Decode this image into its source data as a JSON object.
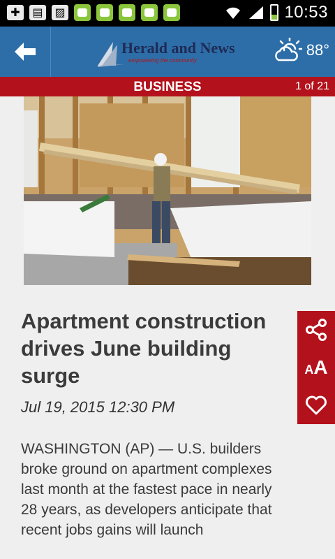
{
  "status_bar": {
    "time": "10:53",
    "battery_level": 0.35,
    "icons": [
      "add-icon",
      "sim-icon",
      "image-icon",
      "android-icon",
      "android-icon",
      "android-icon",
      "android-icon",
      "android-icon",
      "wifi-icon",
      "signal-icon",
      "battery-icon"
    ]
  },
  "header": {
    "logo_title": "Herald and News",
    "logo_tagline": "empowering the community",
    "weather": {
      "icon": "partly-sunny-icon",
      "temperature": "88°"
    }
  },
  "section": {
    "title": "BUSINESS",
    "page_count": "1 of 21"
  },
  "article": {
    "headline": "Apartment construction drives June building surge",
    "date": "Jul 19, 2015 12:30 PM",
    "body": "WASHINGTON (AP) — U.S. builders broke ground on apartment complexes last month at the fastest pace in nearly 28 years, as developers anticipate that recent jobs gains will launch"
  },
  "actions": {
    "font_small": "A",
    "font_big": "A"
  },
  "colors": {
    "header_blue": "#2d6ea8",
    "accent_red": "#b3121c",
    "background": "#efefef"
  }
}
